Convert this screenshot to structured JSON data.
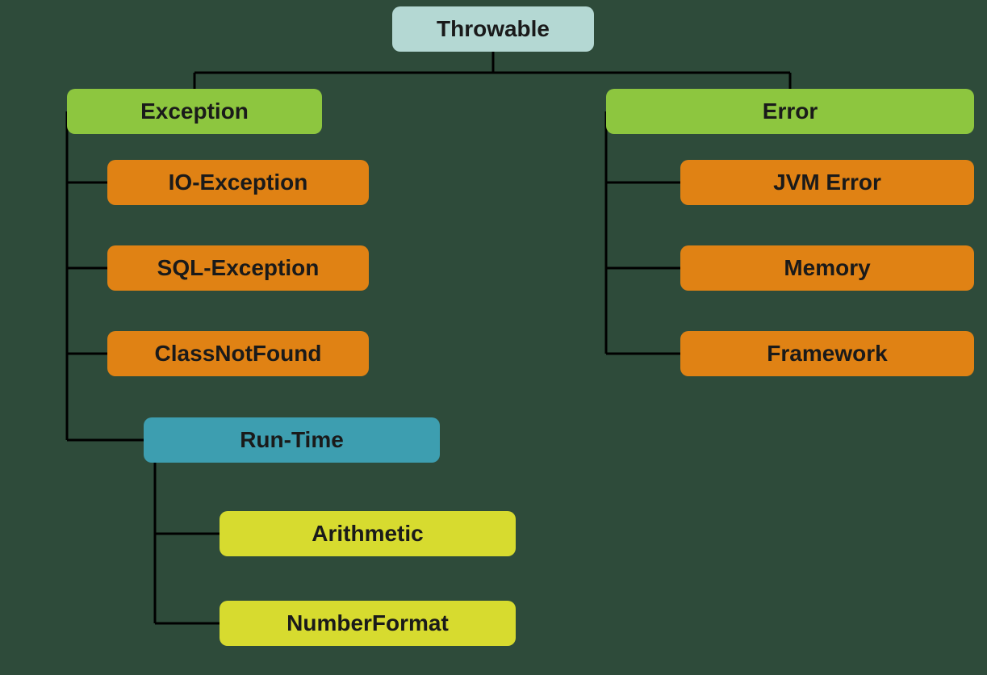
{
  "root": {
    "label": "Throwable"
  },
  "exception": {
    "label": "Exception",
    "children": {
      "io": "IO-Exception",
      "sql": "SQL-Exception",
      "cnf": "ClassNotFound",
      "runtime": {
        "label": "Run-Time",
        "children": {
          "arith": "Arithmetic",
          "nf": "NumberFormat"
        }
      }
    }
  },
  "error": {
    "label": "Error",
    "children": {
      "jvm": "JVM Error",
      "mem": "Memory",
      "fw": "Framework"
    }
  }
}
